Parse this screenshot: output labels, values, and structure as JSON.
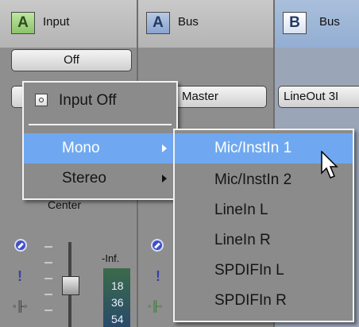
{
  "channels": [
    {
      "badge": "A",
      "label": "Input"
    },
    {
      "badge": "A",
      "label": "Bus"
    },
    {
      "badge": "B",
      "label": "Bus"
    }
  ],
  "buttons": {
    "off": "Off",
    "master": "Master",
    "lineout": "LineOut 3I"
  },
  "strip": {
    "pan_label": "Center",
    "meter_top": "-Inf.",
    "meter_vals": [
      "18",
      "36",
      "54"
    ]
  },
  "main_menu": {
    "items": [
      {
        "label": "Input Off",
        "checked": true
      },
      {
        "label": "Mono",
        "submenu": true,
        "highlighted": true
      },
      {
        "label": "Stereo",
        "submenu": true
      }
    ]
  },
  "sub_menu": {
    "items": [
      {
        "label": "Mic/InstIn 1",
        "highlighted": true
      },
      {
        "label": "Mic/InstIn 2"
      },
      {
        "label": "LineIn L"
      },
      {
        "label": "LineIn R"
      },
      {
        "label": "SPDIFIn L"
      },
      {
        "label": "SPDIFIn R"
      }
    ]
  },
  "colors": {
    "highlight": "#6fa8f1",
    "menu_bg": "#8b8b8b",
    "badge_green": "#8cc36a",
    "badge_blue": "#93aed3"
  }
}
